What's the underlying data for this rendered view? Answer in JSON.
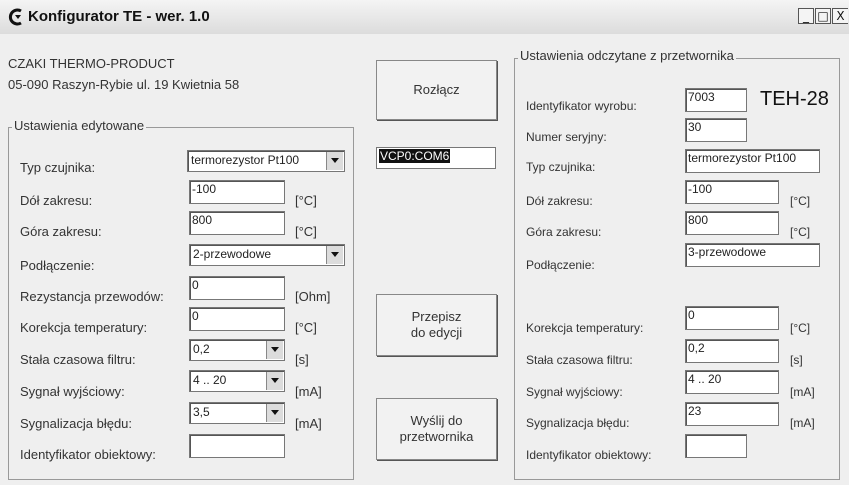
{
  "window": {
    "title": "Konfigurator TE - wer. 1.0",
    "min_label": "_",
    "max_label": "□",
    "close_label": "X"
  },
  "company": {
    "name": "CZAKI THERMO-PRODUCT",
    "address": "05-090 Raszyn-Rybie ul. 19 Kwietnia 58"
  },
  "edit": {
    "group_title": "Ustawienia edytowane",
    "sensor_type_label": "Typ czujnika:",
    "sensor_type_value": "termorezystor Pt100",
    "range_low_label": "Dół zakresu:",
    "range_low_value": "-100",
    "range_low_unit": "[°C]",
    "range_high_label": "Góra zakresu:",
    "range_high_value": "800",
    "range_high_unit": "[°C]",
    "connection_label": "Podłączenie:",
    "connection_value": "2-przewodowe",
    "wire_res_label": "Rezystancja przewodów:",
    "wire_res_value": "0",
    "wire_res_unit": "[Ohm]",
    "temp_corr_label": "Korekcja temperatury:",
    "temp_corr_value": "0",
    "temp_corr_unit": "[°C]",
    "filter_label": "Stała czasowa filtru:",
    "filter_value": "0,2",
    "filter_unit": "[s]",
    "output_label": "Sygnał wyjściowy:",
    "output_value": "4 .. 20",
    "output_unit": "[mA]",
    "error_label": "Sygnalizacja błędu:",
    "error_value": "3,5",
    "error_unit": "[mA]",
    "object_id_label": "Identyfikator obiektowy:",
    "object_id_value": ""
  },
  "middle": {
    "disconnect_label": "Rozłącz",
    "port_value": "VCP0:COM6",
    "copy_label": "Przepisz\ndo edycji",
    "send_label": "Wyślij do\nprzetwornika"
  },
  "read": {
    "group_title": "Ustawienia odczytane z przetwornika",
    "product_id_label": "Identyfikator wyrobu:",
    "product_id_value": "7003",
    "model": "TEH-28",
    "serial_label": "Numer seryjny:",
    "serial_value": "30",
    "sensor_type_label": "Typ czujnika:",
    "sensor_type_value": "termorezystor Pt100",
    "range_low_label": "Dół zakresu:",
    "range_low_value": "-100",
    "range_low_unit": "[°C]",
    "range_high_label": "Góra zakresu:",
    "range_high_value": "800",
    "range_high_unit": "[°C]",
    "connection_label": "Podłączenie:",
    "connection_value": "3-przewodowe",
    "temp_corr_label": "Korekcja temperatury:",
    "temp_corr_value": "0",
    "temp_corr_unit": "[°C]",
    "filter_label": "Stała czasowa filtru:",
    "filter_value": "0,2",
    "filter_unit": "[s]",
    "output_label": "Sygnał wyjściowy:",
    "output_value": "4 .. 20",
    "output_unit": "[mA]",
    "error_label": "Sygnalizacja błędu:",
    "error_value": "23",
    "error_unit": "[mA]",
    "object_id_label": "Identyfikator obiektowy:",
    "object_id_value": ""
  }
}
